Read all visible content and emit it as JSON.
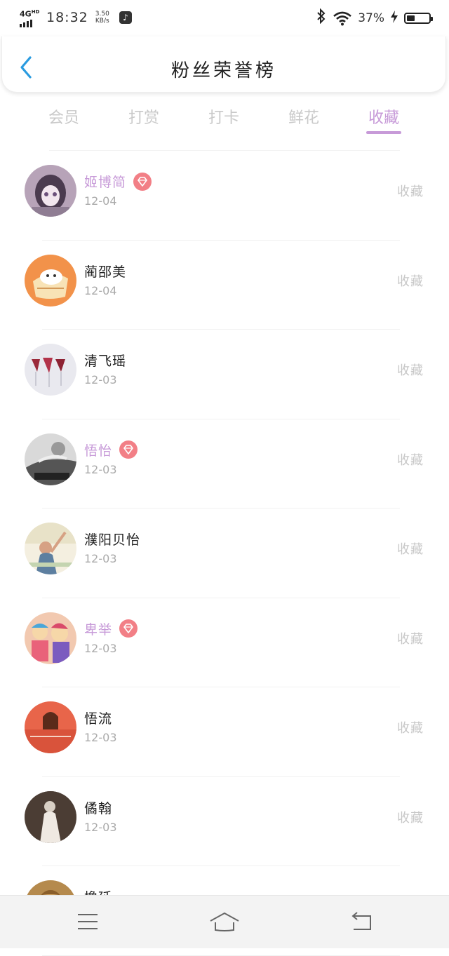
{
  "status_bar": {
    "network": "4G",
    "network_sup": "HD",
    "time": "18:32",
    "speed_value": "3.50",
    "speed_unit": "KB/s",
    "battery_percent": "37%",
    "battery_level": 0.37,
    "icons": [
      "signal-icon",
      "tiktok-icon",
      "bluetooth-icon",
      "wifi-icon",
      "charging-icon",
      "battery-icon"
    ]
  },
  "header": {
    "title": "粉丝荣誉榜",
    "back_icon": "chevron-left-icon",
    "accent_color": "#2a9be0"
  },
  "tabs": [
    {
      "label": "会员",
      "active": false
    },
    {
      "label": "打赏",
      "active": false
    },
    {
      "label": "打卡",
      "active": false
    },
    {
      "label": "鲜花",
      "active": false
    },
    {
      "label": "收藏",
      "active": true
    }
  ],
  "theme": {
    "active_color": "#c79ad8",
    "badge_color": "#f27f86",
    "muted_text": "#c7c7c7"
  },
  "fans": [
    {
      "name": "姬博简",
      "vip": true,
      "date": "12-04",
      "action": "收藏"
    },
    {
      "name": "蔺邵美",
      "vip": false,
      "date": "12-04",
      "action": "收藏"
    },
    {
      "name": "清飞瑶",
      "vip": false,
      "date": "12-03",
      "action": "收藏"
    },
    {
      "name": "悟怡",
      "vip": true,
      "date": "12-03",
      "action": "收藏"
    },
    {
      "name": "濮阳贝怡",
      "vip": false,
      "date": "12-03",
      "action": "收藏"
    },
    {
      "name": "卑举",
      "vip": true,
      "date": "12-03",
      "action": "收藏"
    },
    {
      "name": "悟流",
      "vip": false,
      "date": "12-03",
      "action": "收藏"
    },
    {
      "name": "僪翰",
      "vip": false,
      "date": "12-03",
      "action": "收藏"
    },
    {
      "name": "撸延",
      "vip": false,
      "date": "",
      "action": ""
    }
  ],
  "bottom_nav": {
    "icons": [
      "menu-icon",
      "home-icon",
      "return-icon"
    ]
  }
}
